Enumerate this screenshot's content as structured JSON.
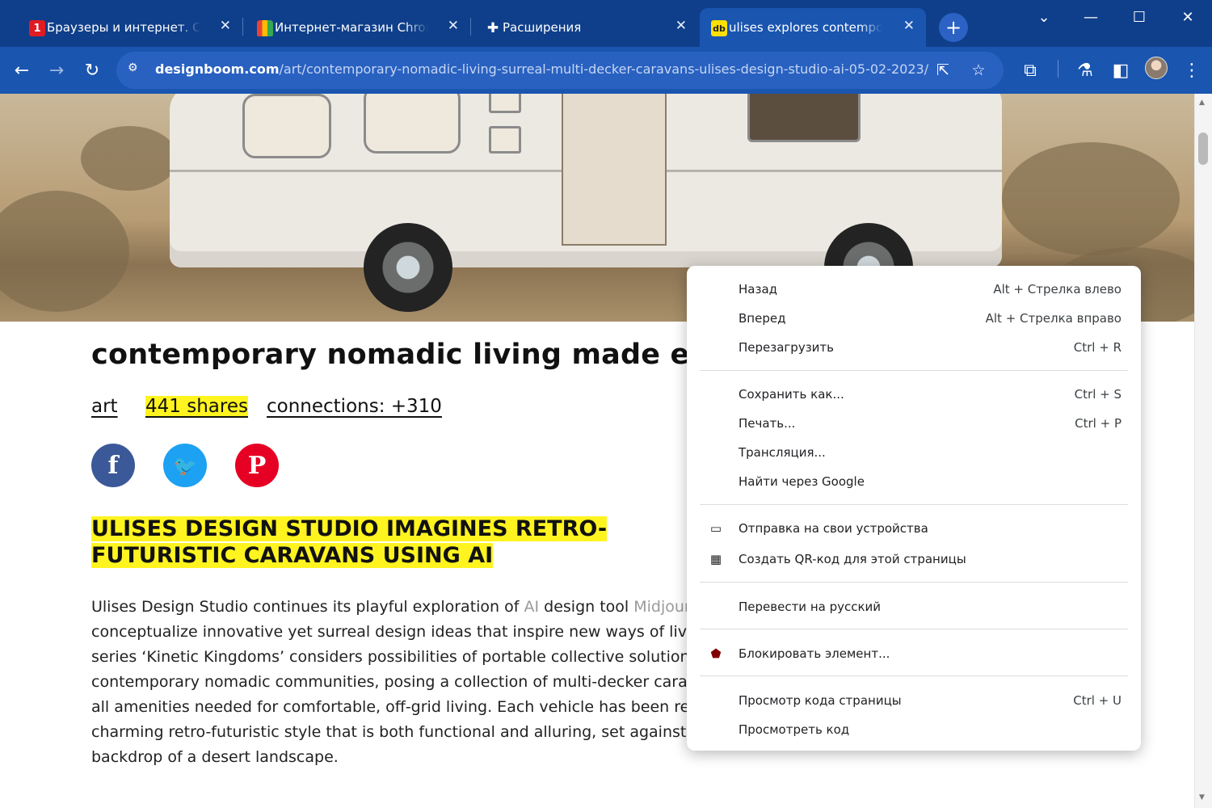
{
  "tabs": [
    {
      "title": "Браузеры и интернет. Скачать",
      "icon": "softportal-icon",
      "icon_color": "#e11b22"
    },
    {
      "title": "Интернет-магазин Chrome",
      "icon": "chrome-webstore-icon",
      "icon_color": "#ffffff"
    },
    {
      "title": "Расширения",
      "icon": "puzzle-icon",
      "icon_color": "#ffffff"
    },
    {
      "title": "ulises explores contemporary",
      "icon": "designboom-icon",
      "icon_color": "#ffe000"
    }
  ],
  "toolbar": {
    "url_domain": "designboom.com",
    "url_path": "/art/contemporary-nomadic-living-surreal-multi-decker-caravans-ulises-design-studio-ai-05-02-2023/"
  },
  "article": {
    "title": "contemporary nomadic living made easier with",
    "meta": {
      "category": "art",
      "shares": "441 shares",
      "connections": "connections: +310"
    },
    "headline": "ULISES DESIGN STUDIO IMAGINES RETRO-FUTURISTIC CARAVANS USING AI",
    "p_lines": [
      "Ulises Design Studio continues its playful exploration of ",
      "AI",
      " design tool ",
      "Midjourney",
      "conceptualize innovative yet surreal design ideas that inspire new ways of living. T",
      "series ‘Kinetic Kingdoms’ considers possibilities of portable collective solutions for",
      "contemporary nomadic communities, posing a collection of multi-decker caravans",
      "all amenities needed for comfortable, off-grid living. Each vehicle has been rendered",
      "charming retro-futuristic style that is both functional and alluring, set against the s",
      "backdrop of a desert landscape."
    ]
  },
  "context_menu": {
    "groups": [
      [
        {
          "label": "Назад",
          "shortcut": "Alt + Стрелка влево",
          "icon": ""
        },
        {
          "label": "Вперед",
          "shortcut": "Alt + Стрелка вправо",
          "icon": ""
        },
        {
          "label": "Перезагрузить",
          "shortcut": "Ctrl + R",
          "icon": ""
        }
      ],
      [
        {
          "label": "Сохранить как...",
          "shortcut": "Ctrl + S",
          "icon": ""
        },
        {
          "label": "Печать...",
          "shortcut": "Ctrl + P",
          "icon": ""
        },
        {
          "label": "Трансляция...",
          "shortcut": "",
          "icon": ""
        },
        {
          "label": "Найти через Google",
          "shortcut": "",
          "icon": ""
        }
      ],
      [
        {
          "label": "Отправка на свои устройства",
          "shortcut": "",
          "icon": "devices-icon"
        },
        {
          "label": "Создать QR-код для этой страницы",
          "shortcut": "",
          "icon": "qr-code-icon"
        }
      ],
      [
        {
          "label": "Перевести на русский",
          "shortcut": "",
          "icon": ""
        }
      ],
      [
        {
          "label": "Блокировать элемент...",
          "shortcut": "",
          "icon": "ublock-icon"
        }
      ],
      [
        {
          "label": "Просмотр кода страницы",
          "shortcut": "Ctrl + U",
          "icon": ""
        },
        {
          "label": "Просмотреть код",
          "shortcut": "",
          "icon": ""
        }
      ]
    ]
  },
  "colors": {
    "chrome_blue": "#1a55b0",
    "highlight": "#fff41f",
    "facebook": "#3b5998",
    "twitter": "#1da1f2",
    "pinterest": "#e60023"
  }
}
